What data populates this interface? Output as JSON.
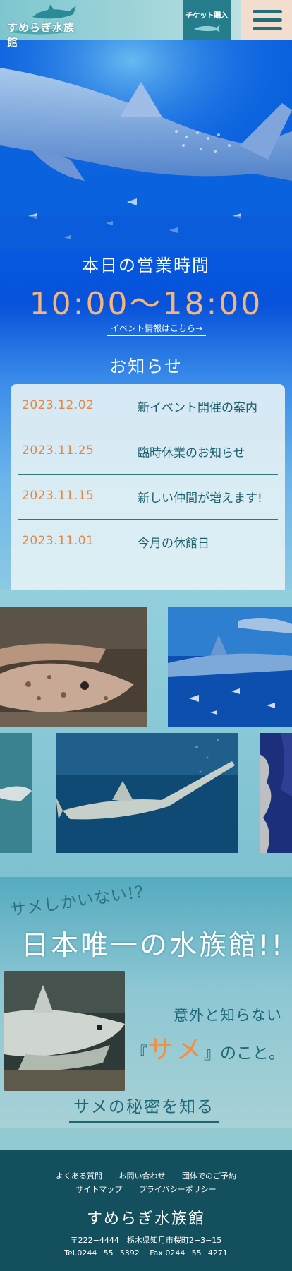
{
  "header": {
    "logo_text": "すめらぎ水族館",
    "ticket_label": "チケット購入"
  },
  "hero": {
    "hours_title": "本日の営業時間",
    "hours_time": "10:00〜18:00",
    "event_link": "イベント情報はこちら→"
  },
  "news": {
    "title": "お知らせ",
    "items": [
      {
        "date": "2023.12.02",
        "title": "新イベント開催の案内"
      },
      {
        "date": "2023.11.25",
        "title": "臨時休業のお知らせ"
      },
      {
        "date": "2023.11.15",
        "title": "新しい仲間が増えます!"
      },
      {
        "date": "2023.11.01",
        "title": "今月の休館日"
      }
    ]
  },
  "feature": {
    "tagline_small": "サメしかいない!?",
    "tagline_big": "日本唯一の水族館!!",
    "line1": "意外と知らない",
    "line2_open": "『",
    "line2_highlight": "サメ",
    "line2_close": "』のこと。",
    "secret_link": "サメの秘密を知る"
  },
  "footer": {
    "links_row1": [
      "よくある質問",
      "お問い合わせ",
      "団体でのご予約"
    ],
    "links_row2": [
      "サイトマップ",
      "プライバシーポリシー"
    ],
    "name": "すめらぎ水族館",
    "address": "〒222−4444　栃木県知月市桜町2−3−15",
    "contact": "Tel.0244−55−5392　 Fax.0244−55−4271"
  },
  "colors": {
    "accent_orange": "#e8853e",
    "teal_dark": "#144f5d",
    "teal": "#257d8c"
  }
}
